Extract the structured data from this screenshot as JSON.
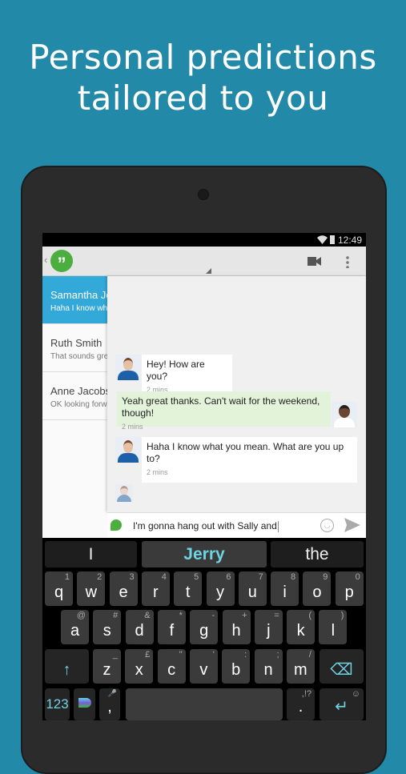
{
  "headline": {
    "line1": "Personal predictions",
    "line2": "tailored to you"
  },
  "colors": {
    "background": "#2389a8",
    "selected": "#33a9d9",
    "accent_key": "#6fd3e3",
    "hangouts_green": "#4cae3f"
  },
  "status_bar": {
    "time": "12:49",
    "icons": [
      "wifi-icon",
      "battery-icon"
    ]
  },
  "action_bar": {
    "icons": [
      "back-chevron-icon",
      "hangouts-logo-icon",
      "video-call-icon",
      "overflow-menu-icon"
    ]
  },
  "conversations": [
    {
      "name": "Samantha Jones",
      "preview": "Haha I know what you mean",
      "selected": true
    },
    {
      "name": "Ruth Smith",
      "preview": "That sounds great",
      "selected": false
    },
    {
      "name": "Anne Jacobs",
      "preview": "OK looking forward",
      "selected": false
    }
  ],
  "messages": [
    {
      "text": "Hey! How are you?",
      "time": "2 mins",
      "from": "them"
    },
    {
      "text": "Yeah great thanks. Can't wait for the weekend, though!",
      "time": "2 mins",
      "from": "me"
    },
    {
      "text": "Haha I know what you mean. What are you up to?",
      "time": "2 mins",
      "from": "them"
    }
  ],
  "compose": {
    "value": "I'm gonna hang out with Sally and"
  },
  "suggestions": [
    "I",
    "Jerry",
    "the"
  ],
  "keyboard": {
    "row1": [
      [
        "q",
        "1"
      ],
      [
        "w",
        "2"
      ],
      [
        "e",
        "3"
      ],
      [
        "r",
        "4"
      ],
      [
        "t",
        "5"
      ],
      [
        "y",
        "6"
      ],
      [
        "u",
        "7"
      ],
      [
        "i",
        "8"
      ],
      [
        "o",
        "9"
      ],
      [
        "p",
        "0"
      ]
    ],
    "row2": [
      [
        "a",
        "@"
      ],
      [
        "s",
        "#"
      ],
      [
        "d",
        "&"
      ],
      [
        "f",
        "*"
      ],
      [
        "g",
        "-"
      ],
      [
        "h",
        "+"
      ],
      [
        "j",
        "="
      ],
      [
        "k",
        "("
      ],
      [
        "l",
        ")"
      ]
    ],
    "row3": [
      [
        "z",
        "_"
      ],
      [
        "x",
        "£"
      ],
      [
        "c",
        "\""
      ],
      [
        "v",
        "'"
      ],
      [
        "b",
        ":"
      ],
      [
        "n",
        ";"
      ],
      [
        "m",
        "/"
      ]
    ],
    "numbers_label": "123",
    "comma": ",",
    "period": ".",
    "period_alt": ",!?"
  }
}
